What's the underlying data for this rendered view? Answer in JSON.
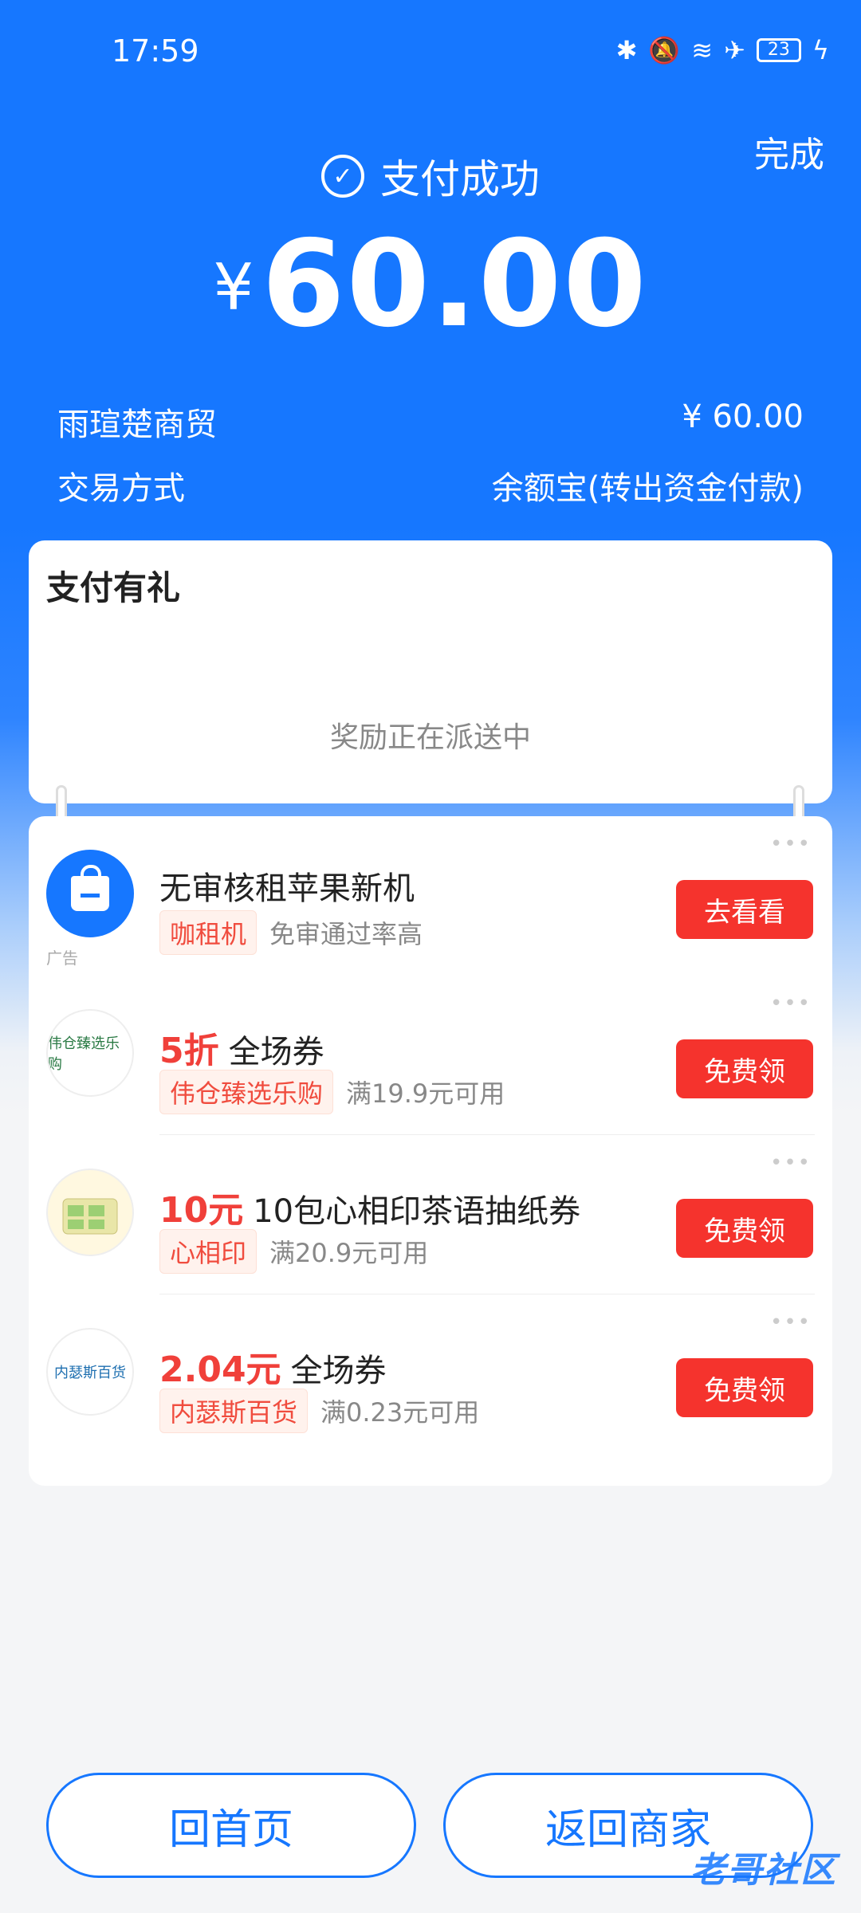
{
  "status_bar": {
    "time": "17:59",
    "battery": "23",
    "icons": [
      "bluetooth-icon",
      "mute-icon",
      "wifi-icon",
      "airplane-icon",
      "battery-icon",
      "charging-icon"
    ]
  },
  "header": {
    "done_label": "完成",
    "status_text": "支付成功",
    "currency": "¥",
    "amount": "60.00"
  },
  "details": {
    "merchant": "雨瑄楚商贸",
    "merchant_amount": "¥ 60.00",
    "method_label": "交易方式",
    "method_value": "余额宝(转出资金付款)"
  },
  "gift": {
    "title": "支付有礼",
    "status": "奖励正在派送中"
  },
  "offers": [
    {
      "highlight": "",
      "title": "无审核租苹果新机",
      "store": "咖租机",
      "condition": "免审通过率高",
      "button": "去看看",
      "ad_label": "广告",
      "logo": ""
    },
    {
      "highlight": "5折",
      "title": "全场券",
      "store": "伟仓臻选乐购",
      "condition": "满19.9元可用",
      "button": "免费领",
      "logo": "伟仓臻选乐购"
    },
    {
      "highlight": "10元",
      "title": "10包心相印茶语抽纸券",
      "store": "心相印",
      "condition": "满20.9元可用",
      "button": "免费领",
      "logo": ""
    },
    {
      "highlight": "2.04元",
      "title": "全场券",
      "store": "内瑟斯百货",
      "condition": "满0.23元可用",
      "button": "免费领",
      "logo": "内瑟斯百货"
    }
  ],
  "footer": {
    "home_label": "回首页",
    "merchant_label": "返回商家",
    "watermark": "老哥社区"
  },
  "colors": {
    "primary": "#1677ff",
    "accent_red": "#f5332d"
  }
}
